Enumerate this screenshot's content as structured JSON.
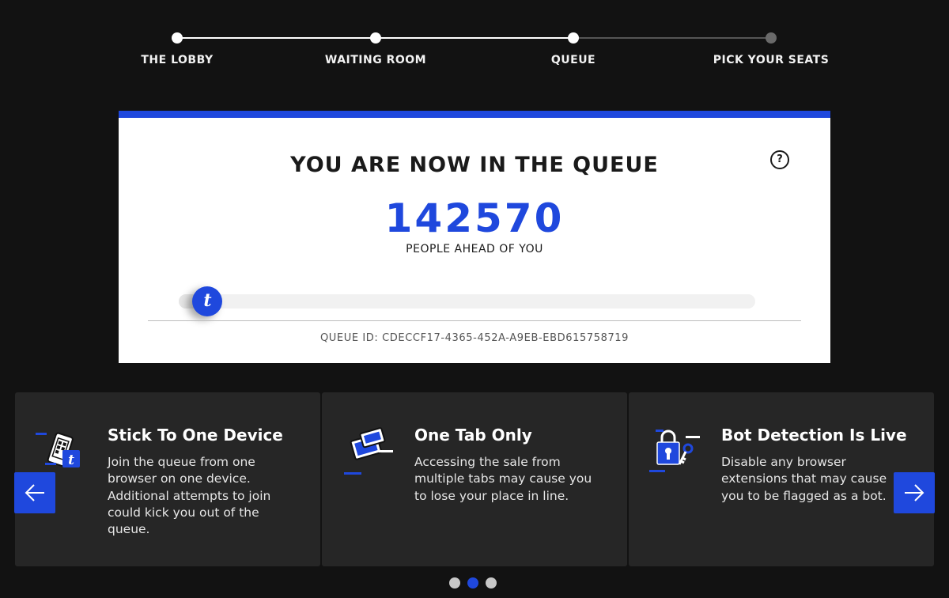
{
  "stepper": {
    "steps": [
      {
        "label": "THE LOBBY"
      },
      {
        "label": "WAITING ROOM"
      },
      {
        "label": "QUEUE"
      },
      {
        "label": "PICK YOUR SEATS"
      }
    ],
    "current_step": 3
  },
  "queue": {
    "title": "YOU ARE NOW IN THE QUEUE",
    "help_glyph": "?",
    "count": "142570",
    "count_label": "PEOPLE AHEAD OF YOU",
    "progress_fraction": 0.05,
    "knob_glyph": "t",
    "queue_id": "QUEUE ID: CDECCF17-4365-452A-A9EB-EBD615758719"
  },
  "tips": [
    {
      "title": "Stick To One Device",
      "text": "Join the queue from one browser on one device. Additional attempts to join could kick you out of the queue.",
      "icon": "phone-icon"
    },
    {
      "title": "One Tab Only",
      "text": "Accessing the sale from multiple tabs may cause you to lose your place in line.",
      "icon": "tabs-icon"
    },
    {
      "title": "Bot Detection Is Live",
      "text": "Disable any browser extensions that may cause you to be flagged as a bot.",
      "icon": "lock-icon"
    }
  ],
  "carousel": {
    "dot_count": 3,
    "active_dot": 2
  },
  "colors": {
    "accent": "#1f48dd",
    "background": "#121212",
    "card": "#262626"
  }
}
